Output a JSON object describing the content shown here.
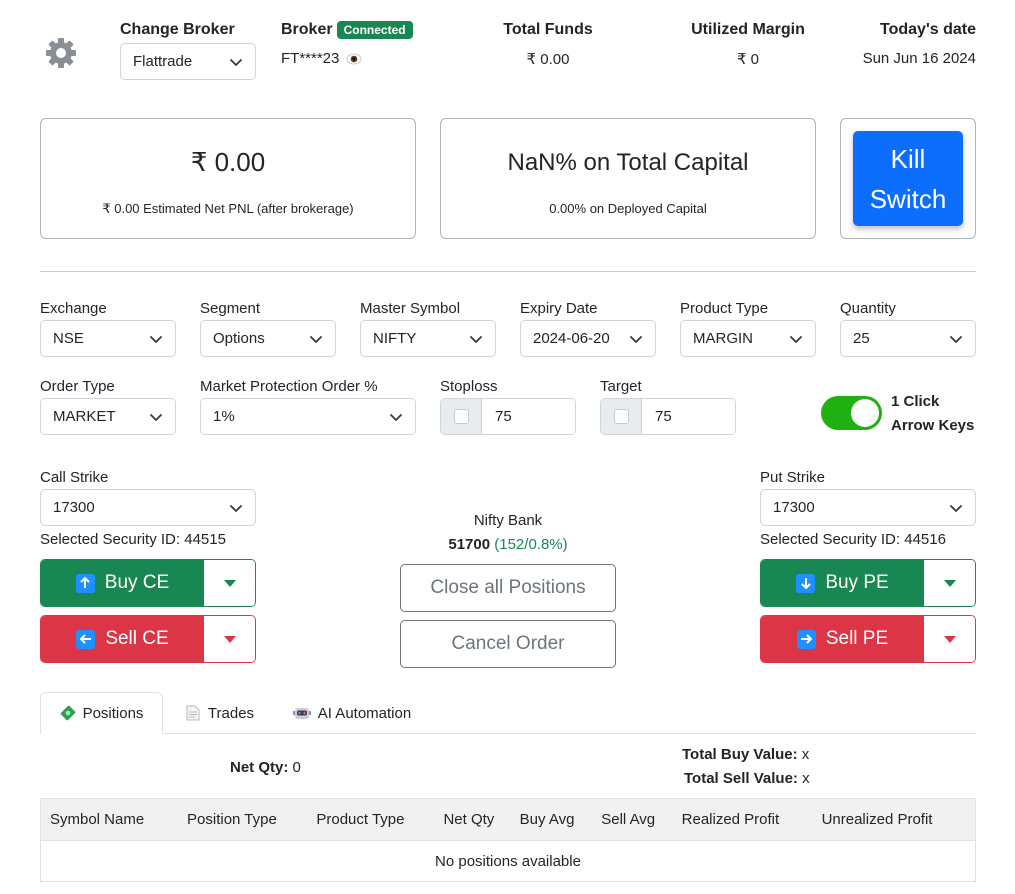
{
  "header": {
    "settings_icon": "gear-icon",
    "change_broker_label": "Change Broker",
    "broker_selected": "Flattrade",
    "broker_label": "Broker",
    "broker_status": "Connected",
    "broker_id": "FT****23",
    "reveal_icon": "eye-icon",
    "total_funds_label": "Total Funds",
    "total_funds_value": "₹ 0.00",
    "utilized_margin_label": "Utilized Margin",
    "utilized_margin_value": "₹ 0",
    "date_label": "Today's date",
    "date_value": "Sun Jun 16 2024"
  },
  "summary": {
    "pnl_value": "₹ 0.00",
    "pnl_sub": "₹ 0.00 Estimated Net PNL (after brokerage)",
    "capital_value": "NaN% on Total Capital",
    "capital_sub": "0.00% on Deployed Capital",
    "kill_switch_line1": "Kill",
    "kill_switch_line2": "Switch"
  },
  "form": {
    "exchange_label": "Exchange",
    "exchange_value": "NSE",
    "segment_label": "Segment",
    "segment_value": "Options",
    "master_symbol_label": "Master Symbol",
    "master_symbol_value": "NIFTY",
    "expiry_label": "Expiry Date",
    "expiry_value": "2024-06-20",
    "product_type_label": "Product Type",
    "product_type_value": "MARGIN",
    "quantity_label": "Quantity",
    "quantity_value": "25",
    "order_type_label": "Order Type",
    "order_type_value": "MARKET",
    "market_protection_label": "Market Protection Order %",
    "market_protection_value": "1%",
    "stoploss_label": "Stoploss",
    "stoploss_value": "75",
    "target_label": "Target",
    "target_value": "75",
    "one_click_line1": "1 Click",
    "one_click_line2": "Arrow Keys"
  },
  "trade": {
    "call_strike_label": "Call Strike",
    "call_strike_value": "17300",
    "call_security": "Selected Security ID: 44515",
    "put_strike_label": "Put Strike",
    "put_strike_value": "17300",
    "put_security": "Selected Security ID: 44516",
    "index_name": "Nifty Bank",
    "index_value": "51700",
    "index_change": "(152/0.8%)",
    "buy_ce": "Buy CE",
    "sell_ce": "Sell CE",
    "buy_pe": "Buy PE",
    "sell_pe": "Sell PE",
    "close_all": "Close all Positions",
    "cancel_order": "Cancel Order"
  },
  "tabs": [
    {
      "label": "Positions",
      "icon": "money-icon"
    },
    {
      "label": "Trades",
      "icon": "document-icon"
    },
    {
      "label": "AI Automation",
      "icon": "robot-icon"
    }
  ],
  "positions": {
    "net_qty_label": "Net Qty:",
    "net_qty_value": "0",
    "total_buy_label": "Total Buy Value:",
    "total_buy_value": "x",
    "total_sell_label": "Total Sell Value:",
    "total_sell_value": "x",
    "columns": [
      "Symbol Name",
      "Position Type",
      "Product Type",
      "Net Qty",
      "Buy Avg",
      "Sell Avg",
      "Realized Profit",
      "Unrealized Profit"
    ],
    "empty_text": "No positions available"
  },
  "colors": {
    "green": "#198754",
    "red": "#dc3545",
    "blue": "#0d6efd",
    "key_blue": "#1e90ff"
  }
}
